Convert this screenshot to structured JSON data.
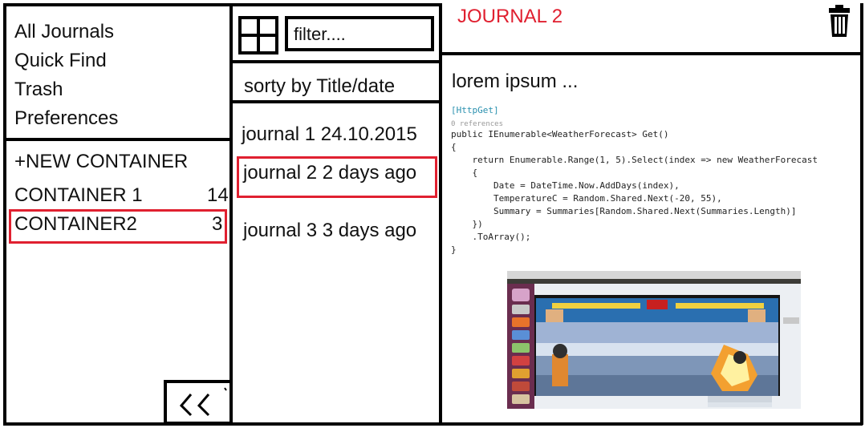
{
  "nav": {
    "items": [
      {
        "label": "All Journals"
      },
      {
        "label": "Quick Find"
      },
      {
        "label": "Trash"
      },
      {
        "label": "Preferences"
      }
    ]
  },
  "containers": {
    "new_label": "+NEW CONTAINER",
    "items": [
      {
        "label": "CONTAINER 1",
        "count": "14"
      },
      {
        "label": "CONTAINER2",
        "count": "3"
      }
    ],
    "collapse_glyph": "<<"
  },
  "list": {
    "filter_placeholder": "filter....",
    "sort_label": "sorty by Title/date",
    "journals": [
      {
        "label": "journal 1 24.10.2015"
      },
      {
        "label": "journal 2 2 days ago"
      },
      {
        "label": "journal 3 3 days ago"
      }
    ]
  },
  "editor": {
    "title": "JOURNAL 2",
    "body": "lorem ipsum ...",
    "code": {
      "attribute": "[HttpGet]",
      "references": "0 references",
      "lines": [
        "public IEnumerable<WeatherForecast> Get()",
        "{",
        "    return Enumerable.Range(1, 5).Select(index => new WeatherForecast",
        "    {",
        "        Date = DateTime.Now.AddDays(index),",
        "        TemperatureC = Random.Shared.Next(-20, 55),",
        "        Summary = Summaries[Random.Shared.Next(Summaries.Length)]",
        "    })",
        "    .ToArray();",
        "}"
      ]
    }
  },
  "colors": {
    "accent_red": "#e02030",
    "border": "#000000"
  }
}
